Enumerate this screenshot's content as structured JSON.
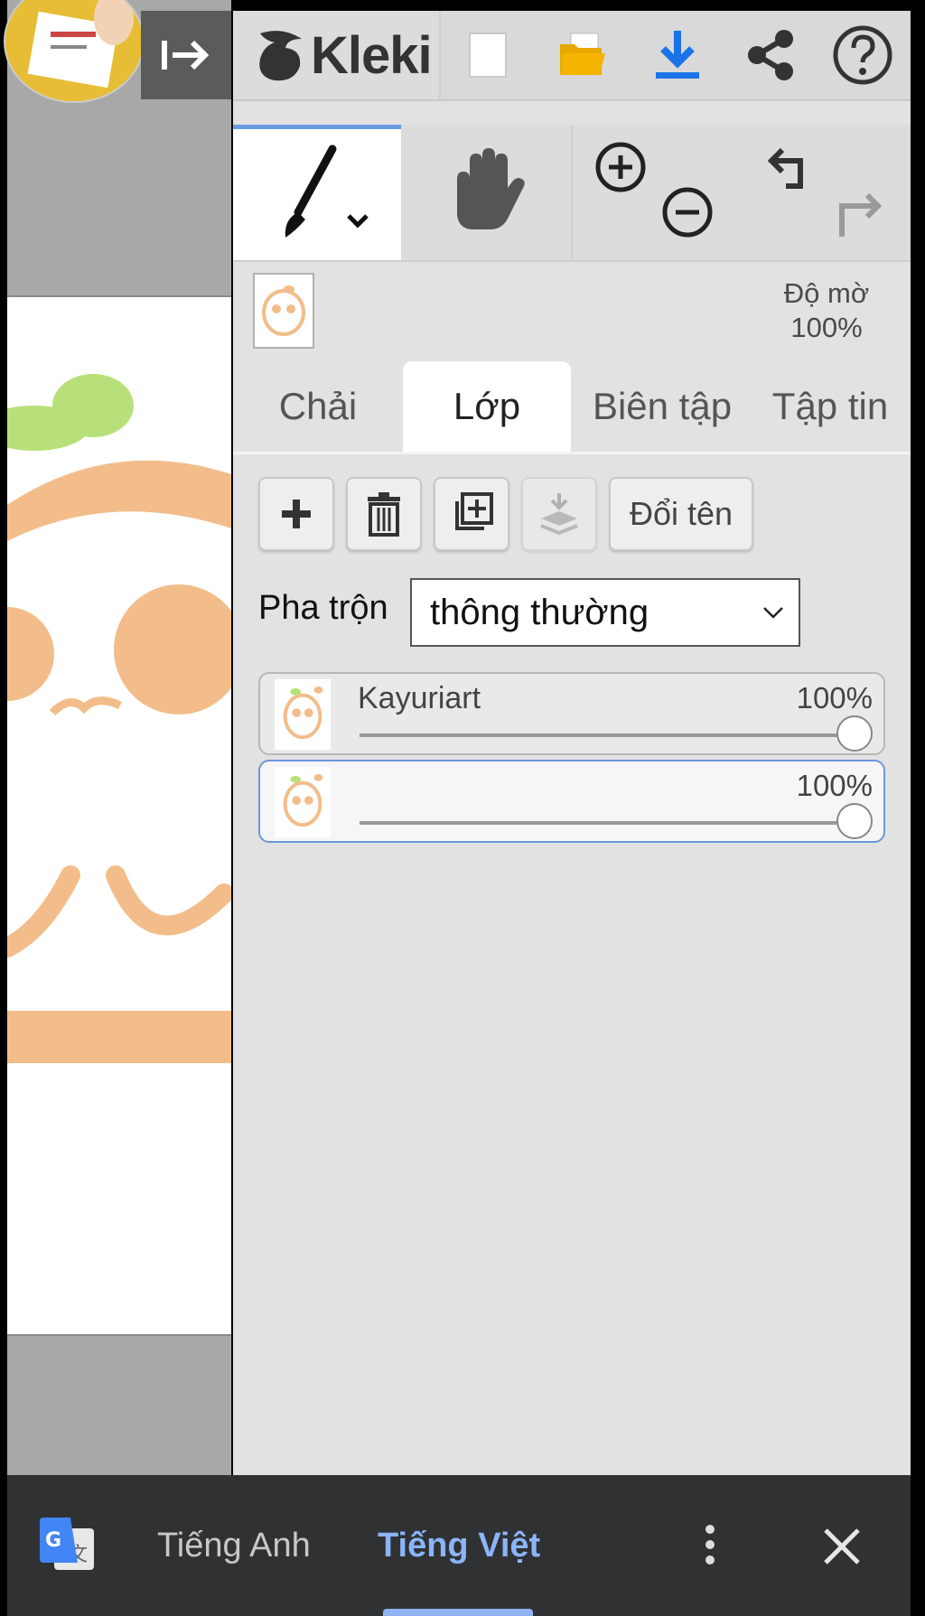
{
  "app": {
    "name": "Kleki"
  },
  "topbar": {
    "hide_ui_icon": "arrow-right-bar-icon",
    "new_icon": "new-document-icon",
    "open_icon": "folder-icon",
    "save_icon": "download-icon",
    "share_icon": "share-icon",
    "help_icon": "help-icon",
    "colors": {
      "save": "#1a73e8",
      "folder": "#f4b400"
    }
  },
  "tools": {
    "brush_icon": "brush-icon",
    "hand_icon": "hand-icon",
    "zoom_in_icon": "zoom-in-icon",
    "zoom_out_icon": "zoom-out-icon",
    "undo_icon": "undo-icon",
    "redo_icon": "redo-icon"
  },
  "opacity": {
    "label": "Độ mờ",
    "value": "100%"
  },
  "tabs": [
    {
      "label": "Chải",
      "active": false
    },
    {
      "label": "Lớp",
      "active": true
    },
    {
      "label": "Biên tập",
      "active": false
    },
    {
      "label": "Tập tin",
      "active": false
    }
  ],
  "layer_buttons": {
    "rename_label": "Đổi tên"
  },
  "blend": {
    "label": "Pha trộn",
    "value": "thông thường"
  },
  "layers": [
    {
      "name": "Kayuriart",
      "opacity": "100%",
      "opacity_value": 100,
      "selected": false
    },
    {
      "name": "",
      "opacity": "100%",
      "opacity_value": 100,
      "selected": true
    }
  ],
  "translate_bar": {
    "source_language": "Tiếng Anh",
    "target_language": "Tiếng Việt",
    "accent": "#8cb4f8"
  }
}
